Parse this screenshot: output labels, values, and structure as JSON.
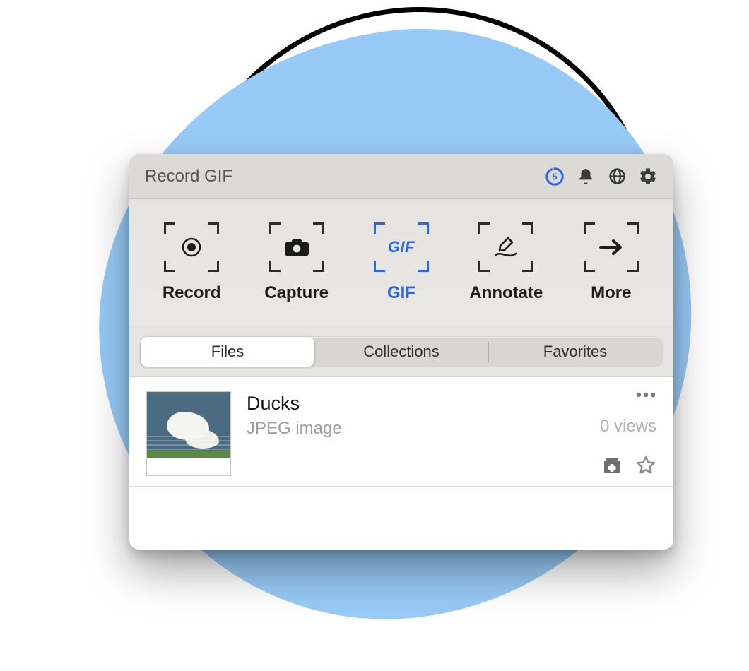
{
  "header": {
    "title": "Record GIF",
    "countdown_value": "5"
  },
  "toolbar": {
    "items": [
      {
        "label": "Record"
      },
      {
        "label": "Capture"
      },
      {
        "label": "GIF"
      },
      {
        "label": "Annotate"
      },
      {
        "label": "More"
      }
    ]
  },
  "tabs": {
    "items": [
      {
        "label": "Files"
      },
      {
        "label": "Collections"
      },
      {
        "label": "Favorites"
      }
    ]
  },
  "files": [
    {
      "title": "Ducks",
      "subtitle": "JPEG image",
      "views_text": "0 views"
    }
  ]
}
